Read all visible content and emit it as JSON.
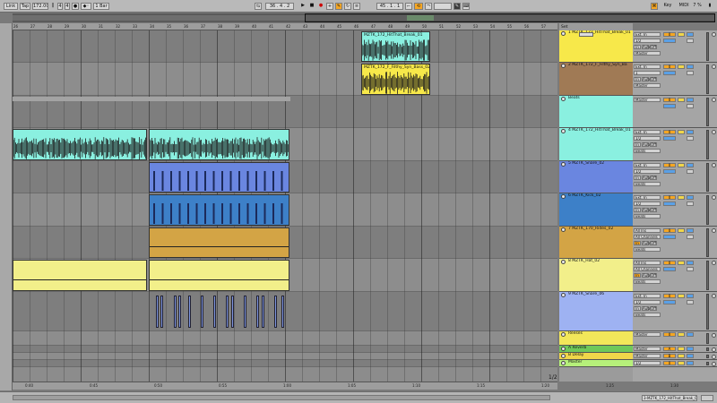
{
  "control_bar": {
    "link_label": "Link",
    "tap_label": "Tap",
    "tempo": "172.00",
    "signature_num": "4",
    "signature_den": "4",
    "quantize": "1 Bar",
    "position": "36 .   4 .   2",
    "loop_start": "45 .   1 .   1",
    "key_label": "Key",
    "midi_label": "MIDI",
    "cpu": "7 %"
  },
  "ruler_ticks": [
    "26",
    "27",
    "28",
    "29",
    "30",
    "31",
    "32",
    "33",
    "34",
    "35",
    "36",
    "37",
    "38",
    "39",
    "40",
    "41",
    "42",
    "43",
    "44",
    "45",
    "46",
    "47",
    "48",
    "49",
    "50",
    "51",
    "52",
    "53",
    "54",
    "55",
    "56",
    "57"
  ],
  "time_ticks": [
    "0:40",
    "0:45",
    "0:50",
    "0:55",
    "1:00",
    "1:05",
    "1:10",
    "1:15",
    "1:20",
    "1:25",
    "1:30"
  ],
  "set_label": "Set",
  "page_indicator": "1/2",
  "status_text": "3-MZTK_172_HitThat_Break_01",
  "tracks": [
    {
      "name": "1 MZTK_172_HitThat_Break_01",
      "color": "#f7e84a",
      "input": "Ext. In",
      "sub": "1/2",
      "out": "Master",
      "vol": "0",
      "clip_name": "MZTK_172_HitThat_Break_01"
    },
    {
      "name": "2 MZTK_172_F_Filthy_Syn_Ba",
      "color": "#a07a55",
      "input": "Ext. In",
      "sub": "1",
      "out": "Master",
      "vol": "0",
      "clip_name": "MZTK_172_F_Filthy_Syn_Bass_02"
    },
    {
      "name": "Beats",
      "color": "#8af0e0",
      "input": "",
      "sub": "",
      "out": "Master",
      "vol": "0",
      "clip_name": ""
    },
    {
      "name": "4 MZTK_172_HitThat_Break_01",
      "color": "#8af0e0",
      "input": "Ext. In",
      "sub": "1/2",
      "out": "Beats",
      "vol": "0",
      "clip_name": ""
    },
    {
      "name": "5 MZTK_Snare_02",
      "color": "#6a86e0",
      "input": "Ext. In",
      "sub": "1/2",
      "out": "Beats",
      "vol": "0",
      "clip_name": ""
    },
    {
      "name": "6 MZTK_Kick_02",
      "color": "#3d80c8",
      "input": "Ext. In",
      "sub": "1/2",
      "out": "Beats",
      "vol": "0",
      "clip_name": ""
    },
    {
      "name": "7 MZTK_170_Rides_02",
      "color": "#d3a445",
      "input": "All Ins",
      "sub": "All Channels",
      "out": "Beats",
      "vol": "0",
      "clip_name": ""
    },
    {
      "name": "8 MZTK_Hat_02",
      "color": "#f2ef8a",
      "input": "All Ins",
      "sub": "All Channels",
      "out": "Beats",
      "vol": "0",
      "clip_name": ""
    },
    {
      "name": "9 MZTK_Snare_06",
      "color": "#9eb2f2",
      "input": "Ext. In",
      "sub": "1/2",
      "out": "Beats",
      "vol": "0",
      "clip_name": ""
    },
    {
      "name": "Reeses",
      "color": "#f2e75a",
      "input": "",
      "sub": "",
      "out": "Master",
      "vol": "0",
      "clip_name": ""
    },
    {
      "name": "A Reverb",
      "color": "#6ec85a",
      "input": "",
      "sub": "",
      "out": "Master",
      "vol": "A",
      "clip_name": ""
    },
    {
      "name": "B Delay",
      "color": "#f0d64a",
      "input": "",
      "sub": "",
      "out": "Master",
      "vol": "B",
      "clip_name": ""
    },
    {
      "name": "Master",
      "color": "#b6f07a",
      "input": "",
      "sub": "",
      "out": "1/2",
      "vol": "0",
      "clip_name": ""
    }
  ],
  "io_labels": {
    "auto": "Auto",
    "off": "Off",
    "in": "In"
  }
}
